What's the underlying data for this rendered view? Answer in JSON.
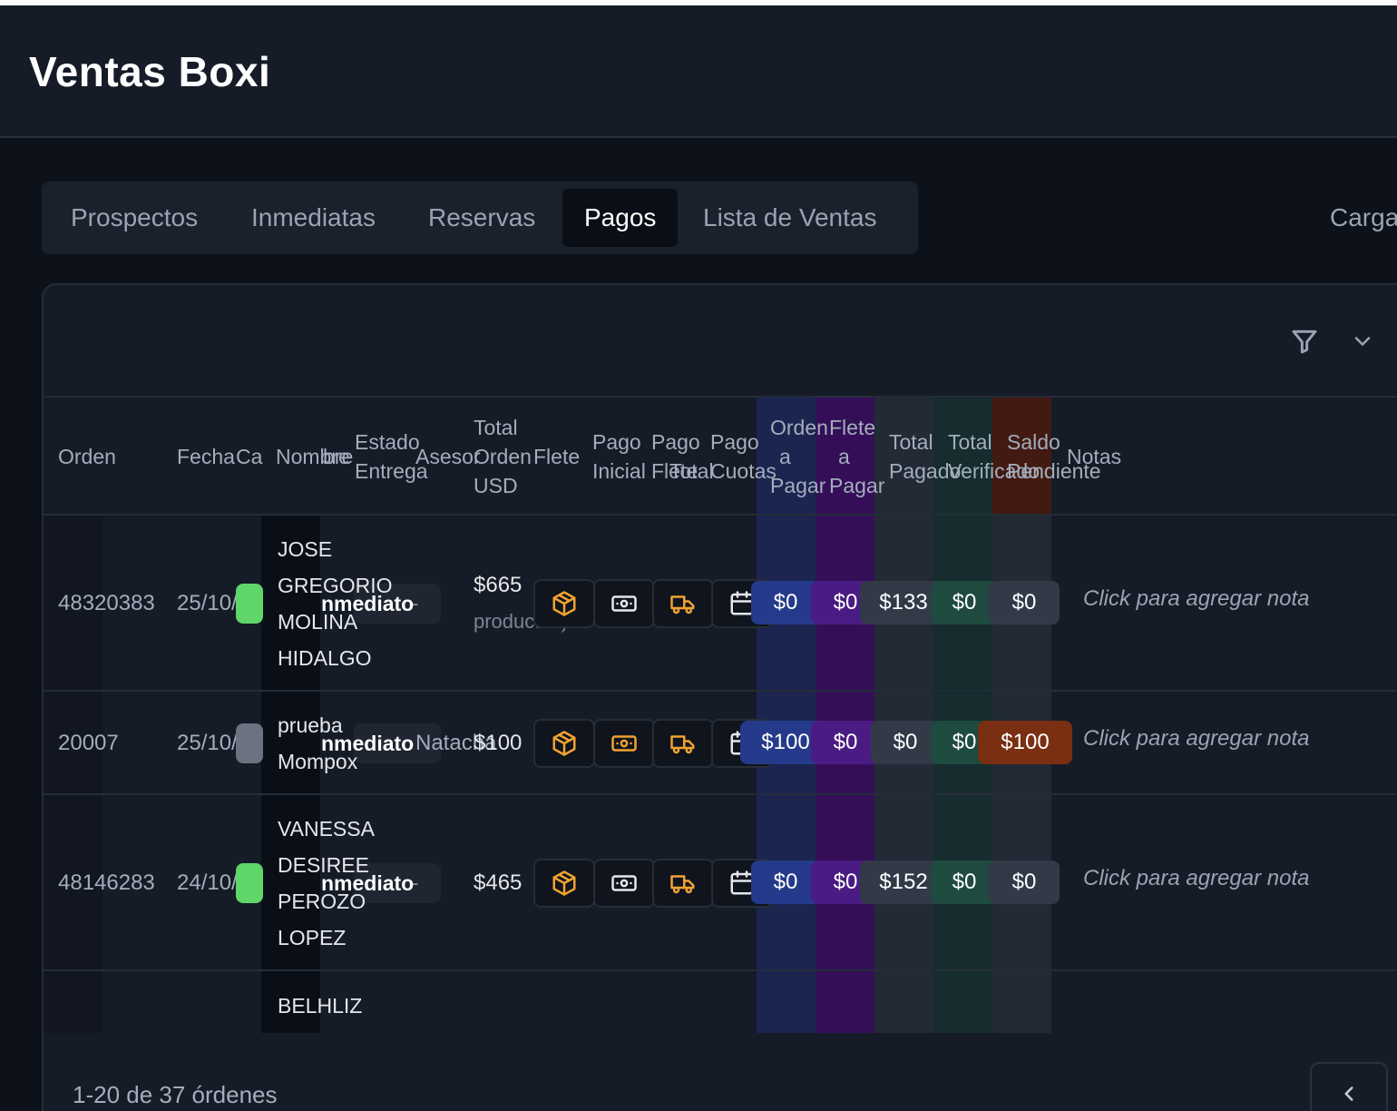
{
  "header": {
    "title": "Ventas Boxi"
  },
  "tabs": [
    {
      "label": "Prospectos"
    },
    {
      "label": "Inmediatas"
    },
    {
      "label": "Reservas"
    },
    {
      "label": "Pagos",
      "active": true
    },
    {
      "label": "Lista de Ventas"
    }
  ],
  "toolbar": {
    "carga_label": "Carga"
  },
  "table": {
    "headers": {
      "orden": "Orden",
      "fecha": "Fecha",
      "canal": "Ca",
      "nombre_a": "Nombre",
      "nombre_b": "bre",
      "estado_1": "Estado",
      "estado_2": "Entrega",
      "asesor": "Asesor",
      "total_orden_1": "Total",
      "total_orden_2": "Orden",
      "total_orden_3": "USD",
      "flete": "Flete",
      "pago_inicial_1": "Pago",
      "pago_inicial_2": "Inicial",
      "pago_flete_1": "Pago",
      "pago_flete_2": "Flete",
      "pago_total": "Total",
      "pago_cuotas_1": "Pago",
      "pago_cuotas_2": "Cuotas",
      "orden_pagar_1": "Orden",
      "orden_pagar_2": "a",
      "orden_pagar_3": "Pagar",
      "flete_pagar_1": "Flete",
      "flete_pagar_2": "a",
      "flete_pagar_3": "Pagar",
      "total_pagado_1": "Total",
      "total_pagado_2": "Pagado",
      "total_verificado_1": "Total",
      "total_verificado_2": "Verificado",
      "saldo_1": "Saldo",
      "saldo_2": "Pendiente",
      "notas": "Notas"
    },
    "rows": [
      {
        "orden": "48320383",
        "fecha": "25/10/",
        "nombre": "JOSE GREGORIO MOLINA HIDALGO",
        "estado": "nmediato",
        "asesor": "-",
        "total": "$665",
        "total_sub": "productos)",
        "orden_pagar": "$0",
        "flete_pagar": "$0",
        "total_pagado": "$133",
        "total_verificado": "$0",
        "saldo": "$0",
        "nota": "Click para agregar nota"
      },
      {
        "orden": "20007",
        "fecha": "25/10/",
        "nombre": "prueba Mompox",
        "estado": "nmediato",
        "asesor": "Natacha",
        "total": "$100",
        "orden_pagar": "$100",
        "flete_pagar": "$0",
        "total_pagado": "$0",
        "total_verificado": "$0",
        "saldo": "$100",
        "nota": "Click para agregar nota"
      },
      {
        "orden": "48146283",
        "fecha": "24/10/",
        "nombre": "VANESSA DESIREE PEROZO LOPEZ",
        "estado": "nmediato",
        "asesor": "-",
        "total": "$465",
        "orden_pagar": "$0",
        "flete_pagar": "$0",
        "total_pagado": "$152",
        "total_verificado": "$0",
        "saldo": "$0",
        "nota": "Click para agregar nota"
      },
      {
        "nombre": "BELHLIZ"
      }
    ]
  },
  "footer": {
    "range_text": "1-20 de 37 órdenes"
  },
  "icons": [
    "filter-icon",
    "chevron-down-icon",
    "package-icon",
    "cash-icon",
    "truck-icon",
    "calendar-icon",
    "chevron-left-icon"
  ],
  "colors": {
    "badge_green": "#5fd56a",
    "badge_gray": "#6b7280",
    "pill_blue": "#253a8a",
    "pill_purple": "#4a1b82",
    "pill_slate": "#323a48",
    "pill_green": "#1e4a40",
    "pill_saldo": "#7a2e12",
    "icon_orange": "#f0a232"
  }
}
